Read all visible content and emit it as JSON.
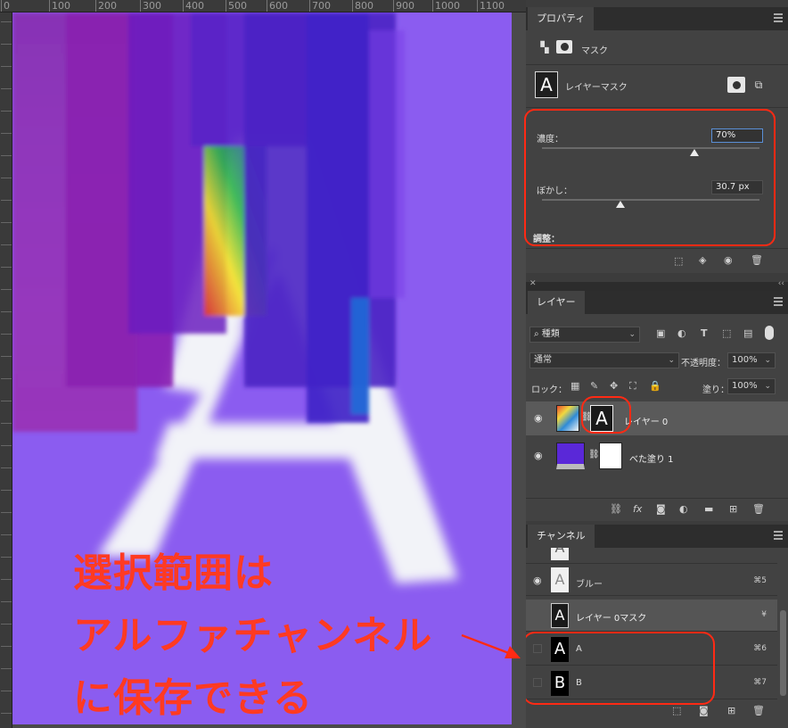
{
  "ruler": {
    "ticks": [
      "0",
      "100",
      "200",
      "300",
      "400",
      "500",
      "600",
      "700",
      "800",
      "900",
      "1000",
      "1100"
    ]
  },
  "canvas": {
    "letter": "A",
    "caption_lines": [
      "選択範囲は",
      "アルファチャンネル",
      "に保存できる"
    ]
  },
  "colors": {
    "accent_red": "#ff2a14",
    "canvas_purple": "#8b5cf0",
    "panel_bg": "#424242"
  },
  "properties": {
    "tab": "プロパティ",
    "mask_label": "マスク",
    "layer_mask_label": "レイヤーマスク",
    "mask_thumb_letter": "A",
    "density_label": "濃度：",
    "density_value": "70%",
    "density_pct": 70,
    "feather_label": "ぼかし：",
    "feather_value": "30.7 px",
    "feather_pct": 36,
    "adjust_label": "調整："
  },
  "layers": {
    "tab": "レイヤー",
    "filter_kind": "種類",
    "blend_mode": "通常",
    "opacity_label": "不透明度：",
    "opacity_value": "100%",
    "lock_label": "ロック：",
    "fill_label": "塗り：",
    "fill_value": "100%",
    "items": [
      {
        "name": "レイヤー 0",
        "mask_letter": "A"
      },
      {
        "name": "べた塗り 1"
      }
    ]
  },
  "channels": {
    "tab": "チャンネル",
    "items": [
      {
        "name": "",
        "shortcut": "",
        "thumb": "A"
      },
      {
        "name": "ブルー",
        "shortcut": "⌘5",
        "thumb": "A"
      },
      {
        "name": "レイヤー 0マスク",
        "shortcut": "¥",
        "thumb": "A"
      },
      {
        "name": "A",
        "shortcut": "⌘6",
        "thumb": "A"
      },
      {
        "name": "B",
        "shortcut": "⌘7",
        "thumb": "B"
      }
    ]
  }
}
